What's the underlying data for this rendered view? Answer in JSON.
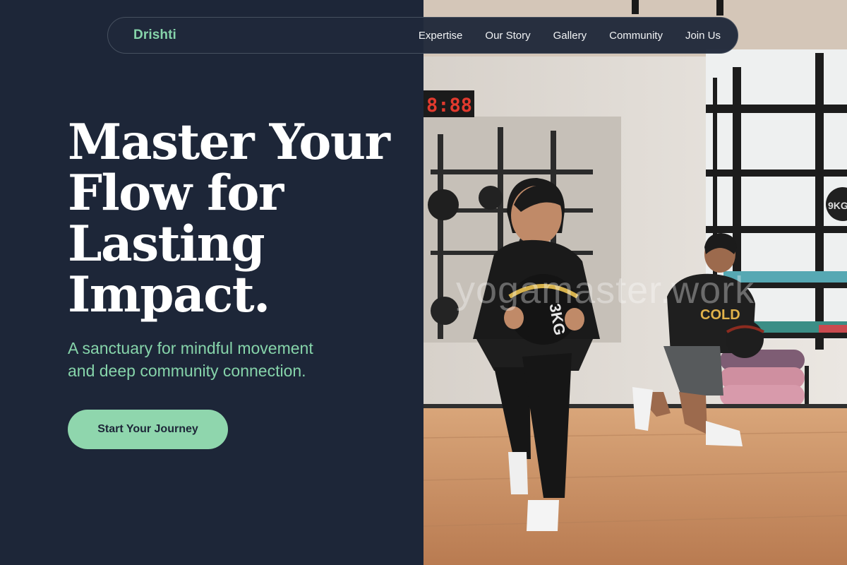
{
  "nav": {
    "brand": "Drishti",
    "links": [
      "Expertise",
      "Our Story",
      "Gallery",
      "Community",
      "Join Us"
    ]
  },
  "hero": {
    "headline_lines": [
      "Master Your",
      "Flow for",
      "Lasting",
      "Impact."
    ],
    "subheadline_lines": [
      "A sanctuary for mindful movement",
      "and deep community connection."
    ],
    "cta_label": "Start Your Journey"
  },
  "photo": {
    "timer_text": "8:88",
    "ball_label_front": "3KG",
    "ball_label_shelf": "9KG",
    "shirt_text": "COLD",
    "watermark": "yogamaster.work"
  },
  "colors": {
    "background": "#1d2638",
    "accent": "#86d4aa",
    "button": "#8fd6ad"
  }
}
